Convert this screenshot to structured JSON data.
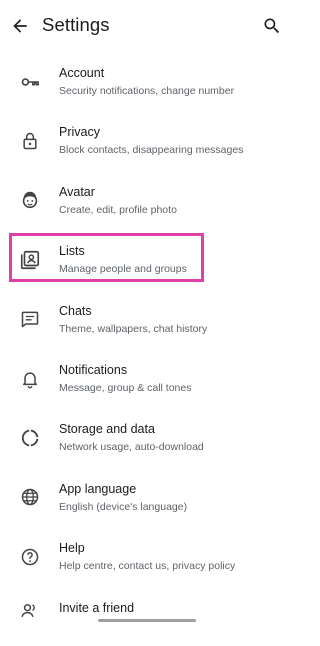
{
  "appbar": {
    "title": "Settings"
  },
  "items": [
    {
      "label": "Account",
      "sub": "Security notifications, change number",
      "icon": "key-icon"
    },
    {
      "label": "Privacy",
      "sub": "Block contacts, disappearing messages",
      "icon": "lock-icon"
    },
    {
      "label": "Avatar",
      "sub": "Create, edit, profile photo",
      "icon": "avatar-face-icon"
    },
    {
      "label": "Lists",
      "sub": "Manage people and groups",
      "icon": "contact-list-icon"
    },
    {
      "label": "Chats",
      "sub": "Theme, wallpapers, chat history",
      "icon": "chat-icon"
    },
    {
      "label": "Notifications",
      "sub": "Message, group & call tones",
      "icon": "bell-icon"
    },
    {
      "label": "Storage and data",
      "sub": "Network usage, auto-download",
      "icon": "storage-ring-icon"
    },
    {
      "label": "App language",
      "sub": "English (device's language)",
      "icon": "globe-icon"
    },
    {
      "label": "Help",
      "sub": "Help centre, contact us, privacy policy",
      "icon": "help-icon"
    },
    {
      "label": "Invite a friend",
      "sub": "",
      "icon": "people-icon"
    }
  ],
  "colors": {
    "highlight": "#e040a6",
    "text": "#1b1b1b",
    "subtext": "#5f6368"
  }
}
